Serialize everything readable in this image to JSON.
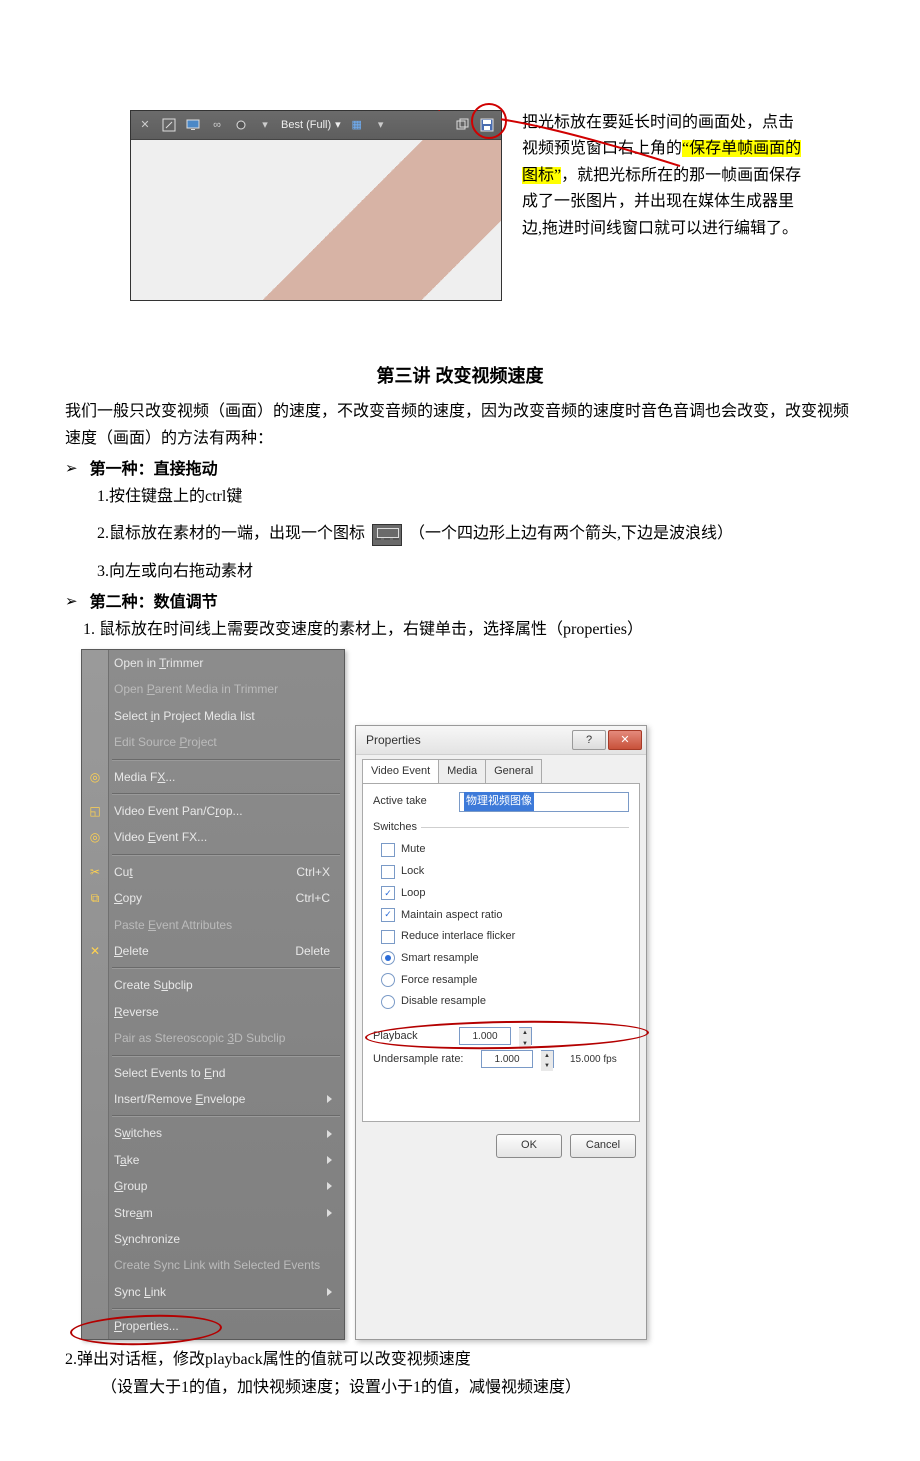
{
  "preview_toolbar": {
    "quality_label": "Best (Full)",
    "save_frame_tooltip": "保存单帧画面的图标"
  },
  "top_text": {
    "line1_pre": "把光标放在要延长时间的画面处，点击视频预览窗口右上角的",
    "highlight": "“保存单帧画面的图标”",
    "line_rest": "，就把光标所在的那一帧画面保存成了一张图片，并出现在媒体生成器里边,拖进时间线窗口就可以进行编辑了。"
  },
  "section": {
    "title": "第三讲 改变视频速度",
    "intro": "我们一般只改变视频（画面）的速度，不改变音频的速度，因为改变音频的速度时音色音调也会改变，改变视频速度（画面）的方法有两种：",
    "method1_title": "第一种：直接拖动",
    "m1_step1": "1.按住键盘上的ctrl键",
    "m1_step2_pre": "2.鼠标放在素材的一端，出现一个图标",
    "m1_step2_post": "（一个四边形上边有两个箭头,下边是波浪线）",
    "m1_step3": "3.向左或向右拖动素材",
    "method2_title": "第二种：数值调节",
    "m2_step1": "1. 鼠标放在时间线上需要改变速度的素材上，右键单击，选择属性（properties）",
    "m2_step2": "2.弹出对话框，修改playback属性的值就可以改变视频速度",
    "m2_hint": "（设置大于1的值，加快视频速度；设置小于1的值，减慢视频速度）"
  },
  "context_menu": {
    "items": [
      {
        "label": "Open in Trimmer",
        "disabled": false,
        "uidx": 8
      },
      {
        "label": "Open Parent Media in Trimmer",
        "disabled": true,
        "uidx": 5
      },
      {
        "label": "Select in Project Media list",
        "disabled": false,
        "uidx": 7
      },
      {
        "label": "Edit Source Project",
        "disabled": true,
        "uidx": 12
      }
    ],
    "group2": [
      {
        "label": "Media FX...",
        "icon": "fx-icon",
        "uidx": 7
      }
    ],
    "group3": [
      {
        "label": "Video Event Pan/Crop...",
        "icon": "crop-icon",
        "uidx": 17
      },
      {
        "label": "Video Event FX...",
        "icon": "fx-icon",
        "uidx": 6
      }
    ],
    "group4": [
      {
        "label": "Cut",
        "icon": "cut-icon",
        "shortcut": "Ctrl+X",
        "uidx": 2
      },
      {
        "label": "Copy",
        "icon": "copy-icon",
        "shortcut": "Ctrl+C",
        "uidx": 0
      },
      {
        "label": "Paste Event Attributes",
        "disabled": true,
        "uidx": 6
      },
      {
        "label": "Delete",
        "icon": "delete-icon",
        "shortcut": "Delete",
        "uidx": 0
      }
    ],
    "group5": [
      {
        "label": "Create Subclip",
        "uidx": 8
      },
      {
        "label": "Reverse",
        "uidx": 0
      },
      {
        "label": "Pair as Stereoscopic 3D Subclip",
        "disabled": true,
        "uidx": 21
      }
    ],
    "group6": [
      {
        "label": "Select Events to End",
        "uidx": 17
      },
      {
        "label": "Insert/Remove Envelope",
        "sub": true,
        "uidx": 14
      }
    ],
    "group7": [
      {
        "label": "Switches",
        "sub": true,
        "uidx": 1
      },
      {
        "label": "Take",
        "sub": true,
        "uidx": 1
      },
      {
        "label": "Group",
        "sub": true,
        "uidx": 0
      },
      {
        "label": "Stream",
        "sub": true,
        "uidx": 4
      },
      {
        "label": "Synchronize",
        "uidx": 1
      },
      {
        "label": "Create Sync Link with Selected Events",
        "disabled": true
      },
      {
        "label": "Sync Link",
        "sub": true,
        "uidx": 5
      }
    ],
    "group8": [
      {
        "label": "Properties...",
        "uidx": 0
      }
    ]
  },
  "dialog": {
    "title": "Properties",
    "tabs": [
      "Video Event",
      "Media",
      "General"
    ],
    "active_take_label": "Active take",
    "active_take_value": "物理视频图像",
    "switches_label": "Switches",
    "switches": {
      "mute": "Mute",
      "lock": "Lock",
      "loop": "Loop",
      "maintain": "Maintain aspect ratio",
      "reduce": "Reduce interlace flicker"
    },
    "resample": {
      "smart": "Smart resample",
      "force": "Force resample",
      "disable": "Disable resample"
    },
    "playback_label": "Playback",
    "playback_value": "1.000",
    "undersample_label": "Undersample rate:",
    "undersample_value": "1.000",
    "fps": "15.000 fps",
    "ok": "OK",
    "cancel": "Cancel"
  }
}
